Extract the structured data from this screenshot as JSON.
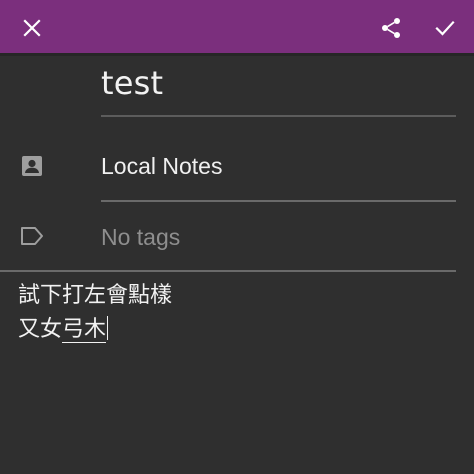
{
  "toolbar": {
    "close_icon": "close-icon",
    "share_icon": "share-icon",
    "save_icon": "check-icon",
    "accent_color": "#7b2f7d"
  },
  "note": {
    "title": "test",
    "notebook_icon": "account-box-icon",
    "notebook": "Local Notes",
    "tags_icon": "label-outline-icon",
    "tags_placeholder": "No tags",
    "body_line_1": "試下打左會點樣",
    "body_line_2_committed": "又女",
    "body_line_2_composing": "弓木"
  }
}
